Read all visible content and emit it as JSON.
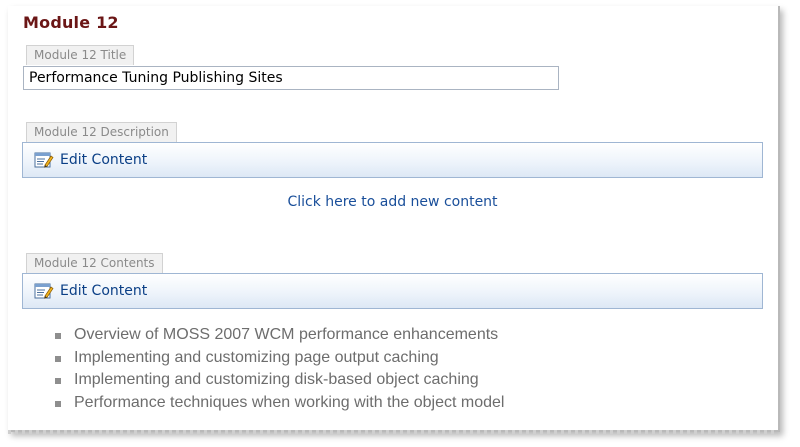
{
  "module": {
    "heading": "Module 12",
    "title_field": {
      "label": "Module 12 Title",
      "value": "Performance Tuning Publishing Sites"
    },
    "description_field": {
      "label": "Module 12 Description",
      "edit_label": "Edit Content",
      "add_link": "Click here to add new content"
    },
    "contents_field": {
      "label": "Module 12 Contents",
      "edit_label": "Edit Content",
      "items": [
        "Overview of MOSS 2007 WCM performance enhancements",
        "Implementing and customizing page output caching",
        "Implementing and customizing disk-based object caching",
        "Performance techniques when working with the object model"
      ]
    }
  },
  "icons": {
    "edit": "edit-content-icon",
    "bullet": "square-bullet-icon"
  },
  "colors": {
    "heading": "#6b1616",
    "link": "#1a4f9a",
    "toolbar_border": "#9fb6d3"
  }
}
